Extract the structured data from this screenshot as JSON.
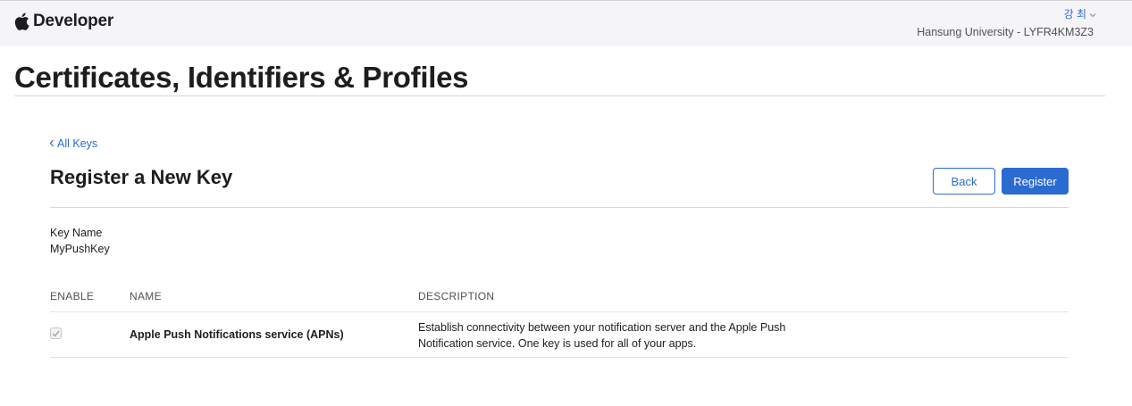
{
  "header": {
    "brand": "Developer",
    "account_name": "강 최",
    "team": "Hansung University - LYFR4KM3Z3"
  },
  "page": {
    "title": "Certificates, Identifiers & Profiles"
  },
  "section": {
    "back_link": "All Keys",
    "title": "Register a New Key",
    "back_button": "Back",
    "register_button": "Register"
  },
  "key": {
    "label": "Key Name",
    "value": "MyPushKey"
  },
  "table": {
    "columns": [
      "ENABLE",
      "NAME",
      "DESCRIPTION"
    ],
    "rows": [
      {
        "enabled": true,
        "name": "Apple Push Notifications service (APNs)",
        "description": "Establish connectivity between your notification server and the Apple Push Notification service. One key is used for all of your apps."
      }
    ]
  },
  "colors": {
    "accent": "#2b6bd1",
    "nav_background": "#f5f5f7",
    "text": "#1d1d1f"
  },
  "icons": {
    "brand": "apple-logo-icon",
    "account_menu": "chevron-down-icon",
    "back": "chevron-left-icon",
    "enable": "checkbox-checked-icon"
  }
}
